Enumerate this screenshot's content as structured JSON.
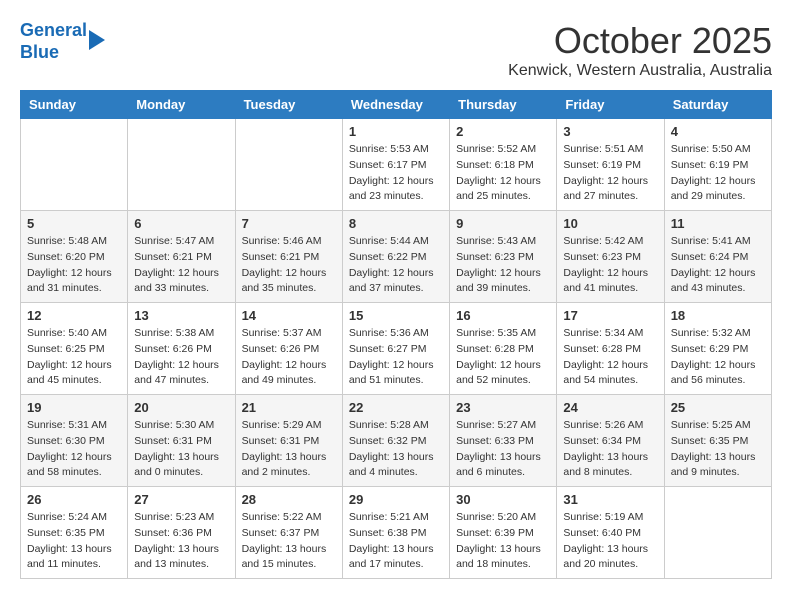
{
  "header": {
    "logo_line1": "General",
    "logo_line2": "Blue",
    "month_title": "October 2025",
    "location": "Kenwick, Western Australia, Australia"
  },
  "weekdays": [
    "Sunday",
    "Monday",
    "Tuesday",
    "Wednesday",
    "Thursday",
    "Friday",
    "Saturday"
  ],
  "rows": [
    [
      {
        "day": "",
        "info": ""
      },
      {
        "day": "",
        "info": ""
      },
      {
        "day": "",
        "info": ""
      },
      {
        "day": "1",
        "info": "Sunrise: 5:53 AM\nSunset: 6:17 PM\nDaylight: 12 hours\nand 23 minutes."
      },
      {
        "day": "2",
        "info": "Sunrise: 5:52 AM\nSunset: 6:18 PM\nDaylight: 12 hours\nand 25 minutes."
      },
      {
        "day": "3",
        "info": "Sunrise: 5:51 AM\nSunset: 6:19 PM\nDaylight: 12 hours\nand 27 minutes."
      },
      {
        "day": "4",
        "info": "Sunrise: 5:50 AM\nSunset: 6:19 PM\nDaylight: 12 hours\nand 29 minutes."
      }
    ],
    [
      {
        "day": "5",
        "info": "Sunrise: 5:48 AM\nSunset: 6:20 PM\nDaylight: 12 hours\nand 31 minutes."
      },
      {
        "day": "6",
        "info": "Sunrise: 5:47 AM\nSunset: 6:21 PM\nDaylight: 12 hours\nand 33 minutes."
      },
      {
        "day": "7",
        "info": "Sunrise: 5:46 AM\nSunset: 6:21 PM\nDaylight: 12 hours\nand 35 minutes."
      },
      {
        "day": "8",
        "info": "Sunrise: 5:44 AM\nSunset: 6:22 PM\nDaylight: 12 hours\nand 37 minutes."
      },
      {
        "day": "9",
        "info": "Sunrise: 5:43 AM\nSunset: 6:23 PM\nDaylight: 12 hours\nand 39 minutes."
      },
      {
        "day": "10",
        "info": "Sunrise: 5:42 AM\nSunset: 6:23 PM\nDaylight: 12 hours\nand 41 minutes."
      },
      {
        "day": "11",
        "info": "Sunrise: 5:41 AM\nSunset: 6:24 PM\nDaylight: 12 hours\nand 43 minutes."
      }
    ],
    [
      {
        "day": "12",
        "info": "Sunrise: 5:40 AM\nSunset: 6:25 PM\nDaylight: 12 hours\nand 45 minutes."
      },
      {
        "day": "13",
        "info": "Sunrise: 5:38 AM\nSunset: 6:26 PM\nDaylight: 12 hours\nand 47 minutes."
      },
      {
        "day": "14",
        "info": "Sunrise: 5:37 AM\nSunset: 6:26 PM\nDaylight: 12 hours\nand 49 minutes."
      },
      {
        "day": "15",
        "info": "Sunrise: 5:36 AM\nSunset: 6:27 PM\nDaylight: 12 hours\nand 51 minutes."
      },
      {
        "day": "16",
        "info": "Sunrise: 5:35 AM\nSunset: 6:28 PM\nDaylight: 12 hours\nand 52 minutes."
      },
      {
        "day": "17",
        "info": "Sunrise: 5:34 AM\nSunset: 6:28 PM\nDaylight: 12 hours\nand 54 minutes."
      },
      {
        "day": "18",
        "info": "Sunrise: 5:32 AM\nSunset: 6:29 PM\nDaylight: 12 hours\nand 56 minutes."
      }
    ],
    [
      {
        "day": "19",
        "info": "Sunrise: 5:31 AM\nSunset: 6:30 PM\nDaylight: 12 hours\nand 58 minutes."
      },
      {
        "day": "20",
        "info": "Sunrise: 5:30 AM\nSunset: 6:31 PM\nDaylight: 13 hours\nand 0 minutes."
      },
      {
        "day": "21",
        "info": "Sunrise: 5:29 AM\nSunset: 6:31 PM\nDaylight: 13 hours\nand 2 minutes."
      },
      {
        "day": "22",
        "info": "Sunrise: 5:28 AM\nSunset: 6:32 PM\nDaylight: 13 hours\nand 4 minutes."
      },
      {
        "day": "23",
        "info": "Sunrise: 5:27 AM\nSunset: 6:33 PM\nDaylight: 13 hours\nand 6 minutes."
      },
      {
        "day": "24",
        "info": "Sunrise: 5:26 AM\nSunset: 6:34 PM\nDaylight: 13 hours\nand 8 minutes."
      },
      {
        "day": "25",
        "info": "Sunrise: 5:25 AM\nSunset: 6:35 PM\nDaylight: 13 hours\nand 9 minutes."
      }
    ],
    [
      {
        "day": "26",
        "info": "Sunrise: 5:24 AM\nSunset: 6:35 PM\nDaylight: 13 hours\nand 11 minutes."
      },
      {
        "day": "27",
        "info": "Sunrise: 5:23 AM\nSunset: 6:36 PM\nDaylight: 13 hours\nand 13 minutes."
      },
      {
        "day": "28",
        "info": "Sunrise: 5:22 AM\nSunset: 6:37 PM\nDaylight: 13 hours\nand 15 minutes."
      },
      {
        "day": "29",
        "info": "Sunrise: 5:21 AM\nSunset: 6:38 PM\nDaylight: 13 hours\nand 17 minutes."
      },
      {
        "day": "30",
        "info": "Sunrise: 5:20 AM\nSunset: 6:39 PM\nDaylight: 13 hours\nand 18 minutes."
      },
      {
        "day": "31",
        "info": "Sunrise: 5:19 AM\nSunset: 6:40 PM\nDaylight: 13 hours\nand 20 minutes."
      },
      {
        "day": "",
        "info": ""
      }
    ]
  ]
}
